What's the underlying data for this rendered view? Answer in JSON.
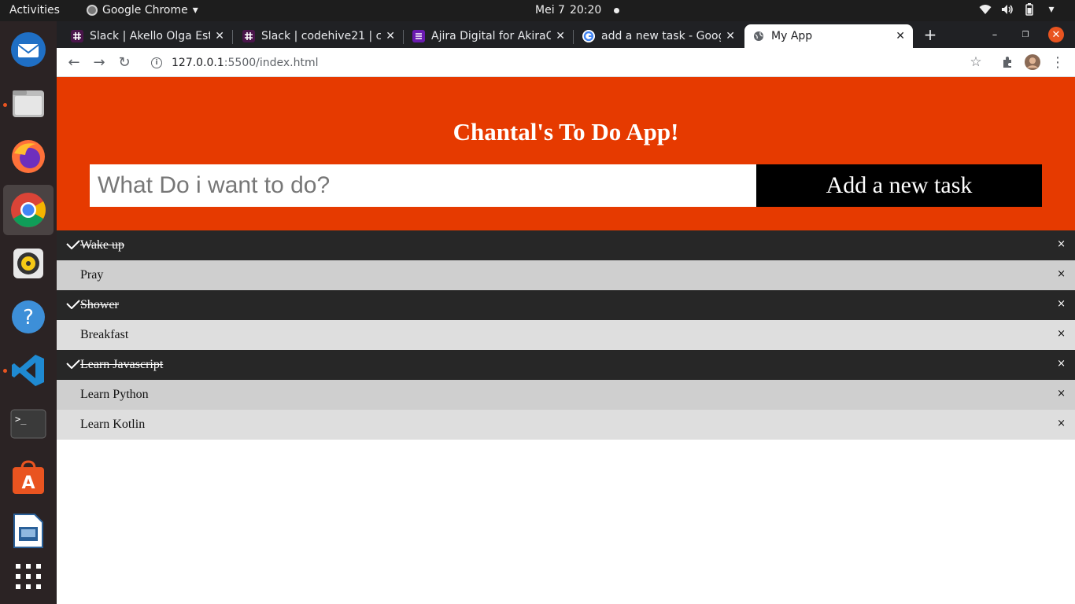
{
  "topbar": {
    "activities": "Activities",
    "app_name": "Google Chrome",
    "date": "Mei 7",
    "time": "20:20"
  },
  "dock": {
    "items": [
      {
        "name": "thunderbird-icon"
      },
      {
        "name": "files-icon"
      },
      {
        "name": "firefox-icon"
      },
      {
        "name": "chrome-icon"
      },
      {
        "name": "rhythmbox-icon"
      },
      {
        "name": "help-icon"
      },
      {
        "name": "vscode-icon"
      },
      {
        "name": "terminal-icon"
      },
      {
        "name": "software-center-icon"
      },
      {
        "name": "libreoffice-impress-icon"
      },
      {
        "name": "show-apps-icon"
      }
    ]
  },
  "browser": {
    "tabs": [
      {
        "title": "Slack | Akello Olga Esth",
        "favicon": "slack-icon"
      },
      {
        "title": "Slack | codehive21 | cod",
        "favicon": "slack-icon"
      },
      {
        "title": "Ajira Digital for AkiraCh",
        "favicon": "forms-icon"
      },
      {
        "title": "add a new task - Google",
        "favicon": "google-icon"
      },
      {
        "title": "My App",
        "favicon": "globe-icon"
      }
    ],
    "url_host": "127.0.0.1",
    "url_path": ":5500/index.html"
  },
  "app": {
    "title": "Chantal's To Do App!",
    "input_placeholder": "What Do i want to do?",
    "add_button": "Add a new task",
    "remove_symbol": "×",
    "tasks": [
      {
        "text": "Wake up",
        "done": true
      },
      {
        "text": "Pray",
        "done": false
      },
      {
        "text": "Shower",
        "done": true
      },
      {
        "text": "Breakfast",
        "done": false
      },
      {
        "text": "Learn Javascript",
        "done": true
      },
      {
        "text": "Learn Python",
        "done": false
      },
      {
        "text": "Learn Kotlin",
        "done": false
      }
    ]
  },
  "colors": {
    "header": "#e63a00",
    "button": "#000000",
    "checked_row": "#272727",
    "row_odd": "#cfcfcf",
    "row_even": "#dedede"
  }
}
